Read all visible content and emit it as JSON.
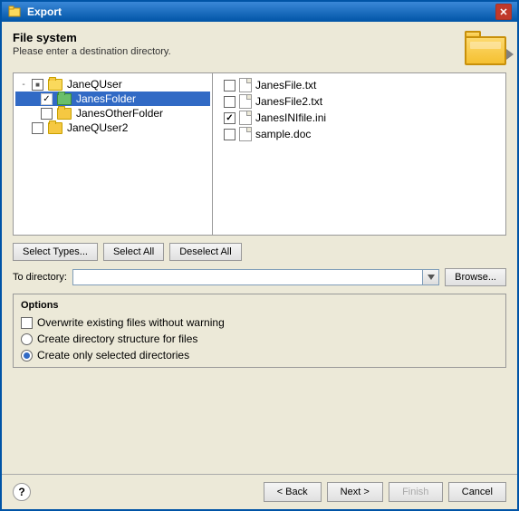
{
  "window": {
    "title": "Export"
  },
  "header": {
    "title": "File system",
    "subtitle": "Please enter a destination directory."
  },
  "left_panel": {
    "tree": [
      {
        "id": "janequser",
        "label": "JaneQUser",
        "indent": 0,
        "expanded": true,
        "checkbox": "partial",
        "toggle": "-"
      },
      {
        "id": "janesfolder",
        "label": "JanesFolder",
        "indent": 1,
        "selected": true,
        "checkbox": "checked",
        "toggle": ""
      },
      {
        "id": "janesotherfolder",
        "label": "JanesOtherFolder",
        "indent": 1,
        "checkbox": "unchecked",
        "toggle": ""
      },
      {
        "id": "janequser2",
        "label": "JaneQUser2",
        "indent": 0,
        "checkbox": "unchecked",
        "toggle": ""
      }
    ]
  },
  "right_panel": {
    "files": [
      {
        "id": "janesfile",
        "label": "JanesFile.txt",
        "checked": false
      },
      {
        "id": "janesfile2",
        "label": "JanesFile2.txt",
        "checked": false
      },
      {
        "id": "janesinifile",
        "label": "JanesINIfile.ini",
        "checked": true
      },
      {
        "id": "sampledoc",
        "label": "sample.doc",
        "checked": false
      }
    ]
  },
  "buttons": {
    "select_types": "Select Types...",
    "select_all": "Select All",
    "deselect_all": "Deselect All"
  },
  "directory": {
    "label": "To directory:",
    "value": "",
    "placeholder": "",
    "browse": "Browse..."
  },
  "options": {
    "title": "Options",
    "items": [
      {
        "id": "overwrite",
        "type": "checkbox",
        "label": "Overwrite existing files without warning",
        "checked": false
      },
      {
        "id": "create_dir_structure",
        "type": "radio",
        "label": "Create directory structure for files",
        "selected": false
      },
      {
        "id": "create_selected_dirs",
        "type": "radio",
        "label": "Create only selected directories",
        "selected": true
      }
    ]
  },
  "footer": {
    "help_label": "?",
    "back_label": "< Back",
    "next_label": "Next >",
    "finish_label": "Finish",
    "cancel_label": "Cancel"
  }
}
